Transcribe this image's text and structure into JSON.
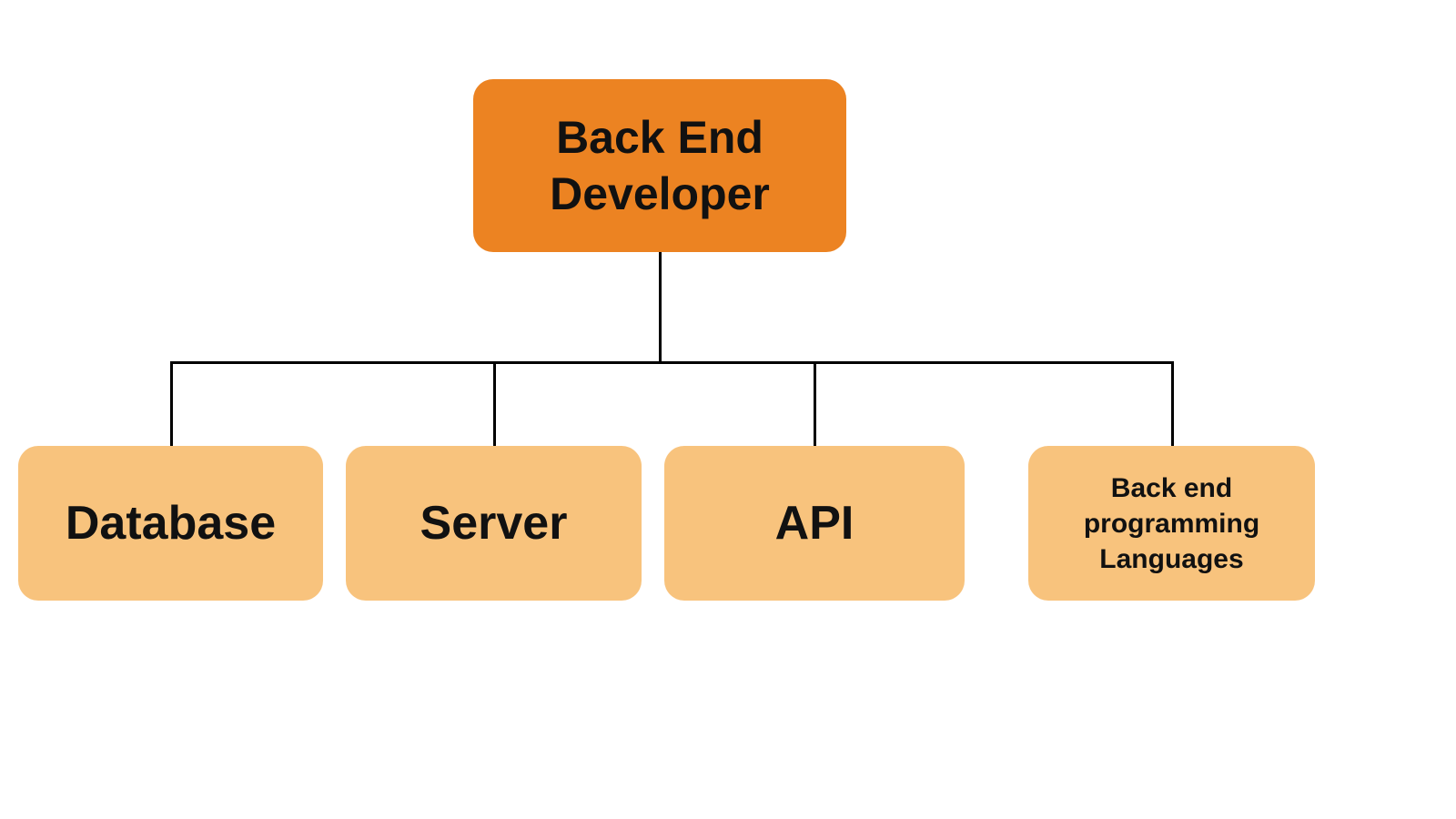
{
  "diagram": {
    "root": {
      "label": "Back End\nDeveloper"
    },
    "children": [
      {
        "label": "Database"
      },
      {
        "label": "Server"
      },
      {
        "label": "API"
      },
      {
        "label": "Back end\nprogramming\nLanguages"
      }
    ],
    "colors": {
      "root_bg": "#ec8322",
      "child_bg": "#f8c37d",
      "text": "#111111",
      "line": "#000000"
    }
  }
}
